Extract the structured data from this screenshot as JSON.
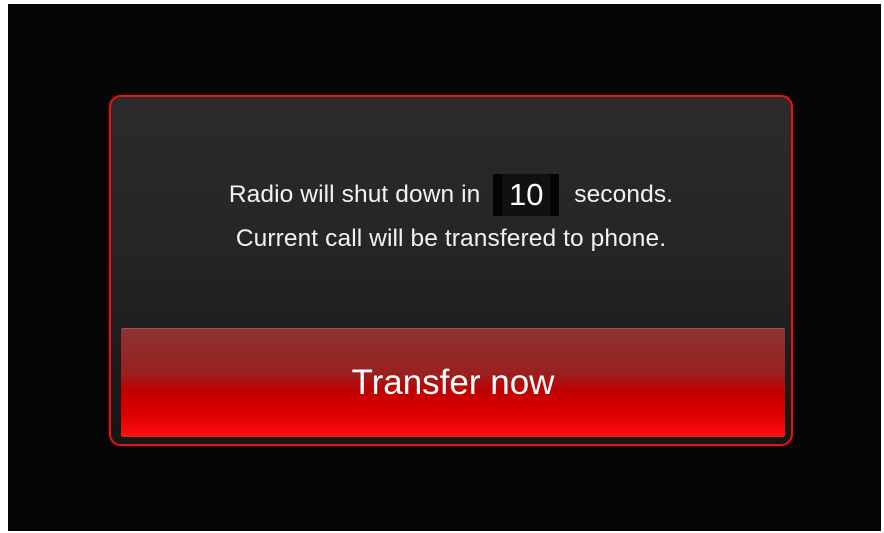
{
  "dialog": {
    "message_line1_before": "Radio will shut down in",
    "countdown_value": "10",
    "message_line1_after": "seconds.",
    "message_line2": "Current call will be transfered to phone."
  },
  "actions": {
    "transfer_label": "Transfer now"
  },
  "colors": {
    "accent": "#e01717",
    "background": "#050505",
    "button_red": "#e00000",
    "text": "#f2f2f2"
  }
}
